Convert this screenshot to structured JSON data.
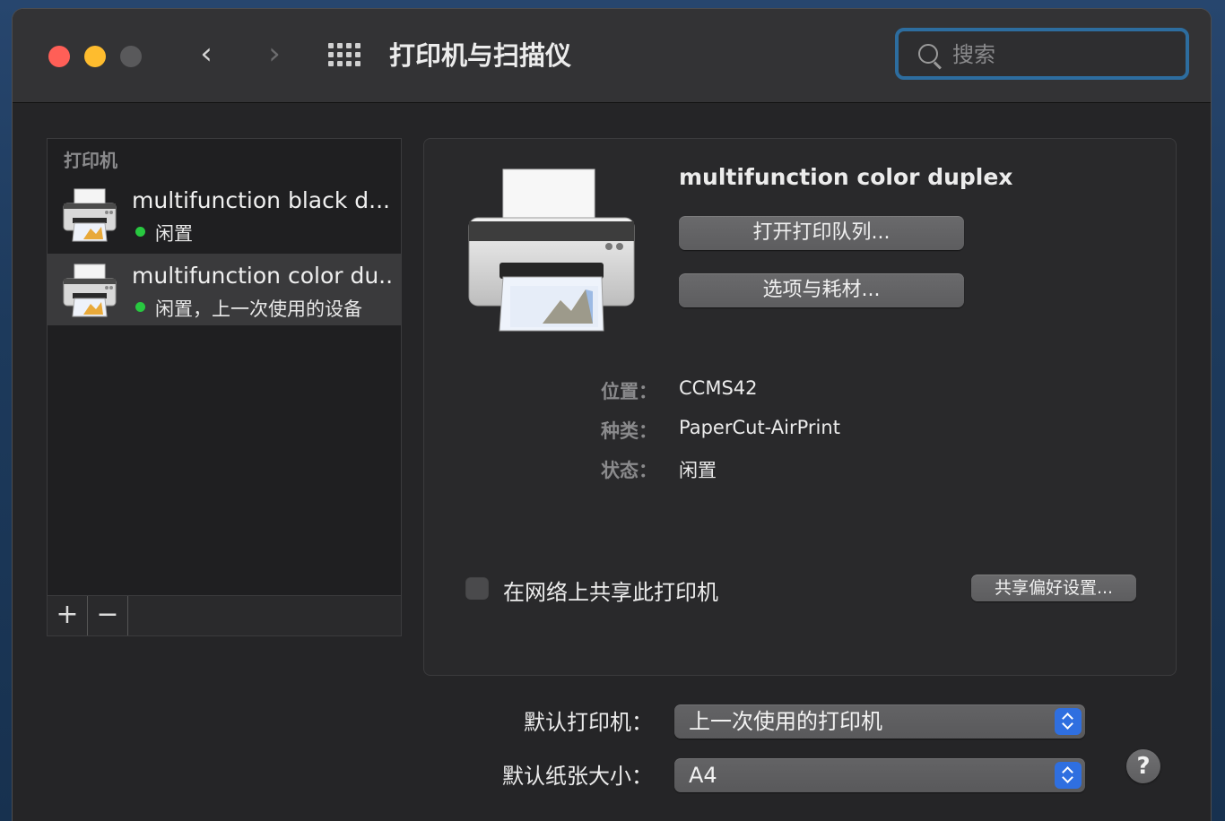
{
  "window": {
    "title": "打印机与扫描仪"
  },
  "search": {
    "placeholder": "搜索"
  },
  "nav": {
    "back_icon": "‹",
    "forward_icon": "›"
  },
  "sidebar": {
    "header": "打印机",
    "printers": [
      {
        "name": "multifunction black d...",
        "status": "闲置",
        "status_color": "#28c840",
        "selected": false
      },
      {
        "name": "multifunction color du...",
        "status": "闲置，上一次使用的设备",
        "status_color": "#28c840",
        "selected": true
      }
    ],
    "add_label": "+",
    "remove_label": "−"
  },
  "detail": {
    "printer_name": "multifunction color duplex",
    "open_queue_label": "打开打印队列...",
    "options_label": "选项与耗材...",
    "info": [
      {
        "label": "位置：",
        "value": "CCMS42"
      },
      {
        "label": "种类：",
        "value": "PaperCut-AirPrint"
      },
      {
        "label": "状态：",
        "value": "闲置"
      }
    ],
    "share_label": "在网络上共享此打印机",
    "share_checked": false,
    "share_prefs_label": "共享偏好设置..."
  },
  "defaults": {
    "printer_label": "默认打印机：",
    "printer_value": "上一次使用的打印机",
    "paper_label": "默认纸张大小：",
    "paper_value": "A4"
  },
  "help": {
    "label": "?"
  },
  "colors": {
    "accent": "#2f6fe0",
    "close": "#ff5f57",
    "minimize": "#febc2e",
    "status_idle": "#28c840"
  }
}
